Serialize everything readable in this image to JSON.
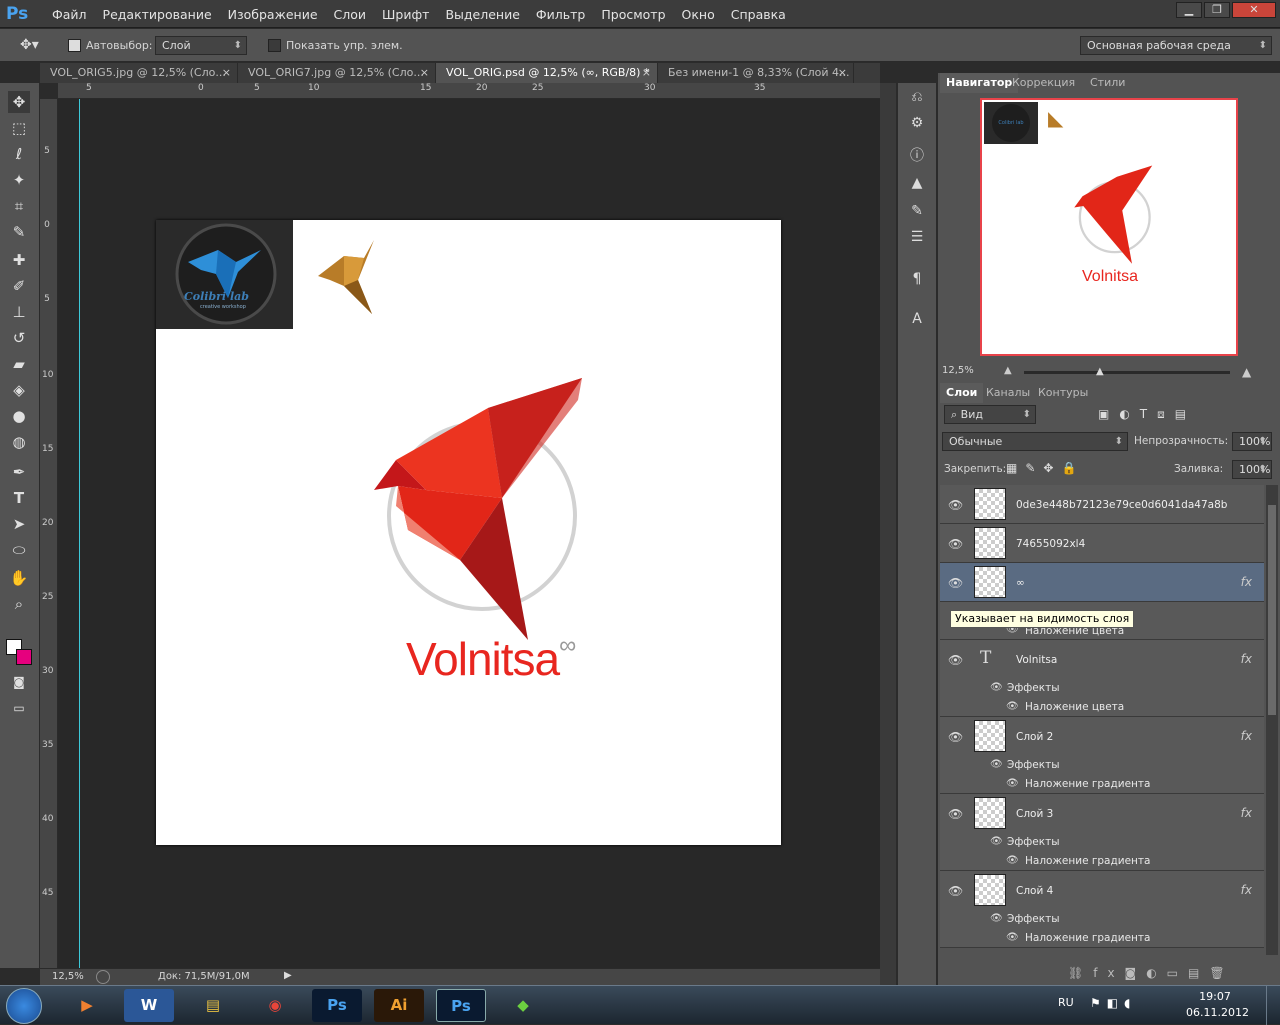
{
  "app": {
    "logo": "Ps"
  },
  "menu": [
    "Файл",
    "Редактирование",
    "Изображение",
    "Слои",
    "Шрифт",
    "Выделение",
    "Фильтр",
    "Просмотр",
    "Окно",
    "Справка"
  ],
  "options": {
    "autoselect_label": "Автовыбор:",
    "autoselect_value": "Слой",
    "show_controls_label": "Показать упр. элем.",
    "workspace_value": "Основная рабочая среда"
  },
  "tabs": [
    {
      "label": "VOL_ORIG5.jpg @ 12,5% (Сло..."
    },
    {
      "label": "VOL_ORIG7.jpg @ 12,5% (Сло..."
    },
    {
      "label": "VOL_ORIG.psd @ 12,5% (∞, RGB/8) *"
    },
    {
      "label": "Без имени-1 @ 8,33% (Слой 4..."
    }
  ],
  "ruler": {
    "top": [
      "5",
      "0",
      "5",
      "10",
      "15",
      "20",
      "25",
      "30",
      "35"
    ],
    "left": [
      "5",
      "0",
      "5",
      "10",
      "15",
      "20",
      "25",
      "30",
      "35",
      "40",
      "45"
    ]
  },
  "canvas": {
    "logo_text": "Colibri lab",
    "logo_sub": "creative workshop",
    "brand": "Volnitsa",
    "brand_suffix": "∞"
  },
  "status": {
    "zoom": "12,5%",
    "doc": "Док: 71,5M/91,0M"
  },
  "navigator": {
    "tabs": [
      "Навигатор",
      "Коррекция",
      "Стили"
    ],
    "zoom": "12,5%",
    "preview_brand": "Volnitsa",
    "preview_logo": "Colibri lab"
  },
  "layers_panel": {
    "tabs": [
      "Слои",
      "Каналы",
      "Контуры"
    ],
    "filter": "Вид",
    "blend": "Обычные",
    "opacity_label": "Непрозрачность:",
    "opacity": "100%",
    "lock_label": "Закрепить:",
    "fill_label": "Заливка:",
    "fill": "100%",
    "layers": [
      {
        "name": "0de3e448b72123e79ce0d6041da47a8b"
      },
      {
        "name": "74655092xl4"
      },
      {
        "name": "∞",
        "effect": "Наложение цвета"
      },
      {
        "name": "Volnitsa",
        "effects": "Эффекты",
        "effect": "Наложение цвета"
      },
      {
        "name": "Слой 2",
        "effects": "Эффекты",
        "effect": "Наложение градиента"
      },
      {
        "name": "Слой 3",
        "effects": "Эффекты",
        "effect": "Наложение градиента"
      },
      {
        "name": "Слой 4",
        "effects": "Эффекты",
        "effect": "Наложение градиента"
      }
    ],
    "fx": "fx",
    "tooltip": "Указывает на видимость слоя"
  },
  "taskbar": {
    "lang": "RU",
    "time": "19:07",
    "date": "06.11.2012"
  },
  "colors": {
    "brand_red": "#e8261f",
    "accent_blue": "#3dc9d9"
  }
}
